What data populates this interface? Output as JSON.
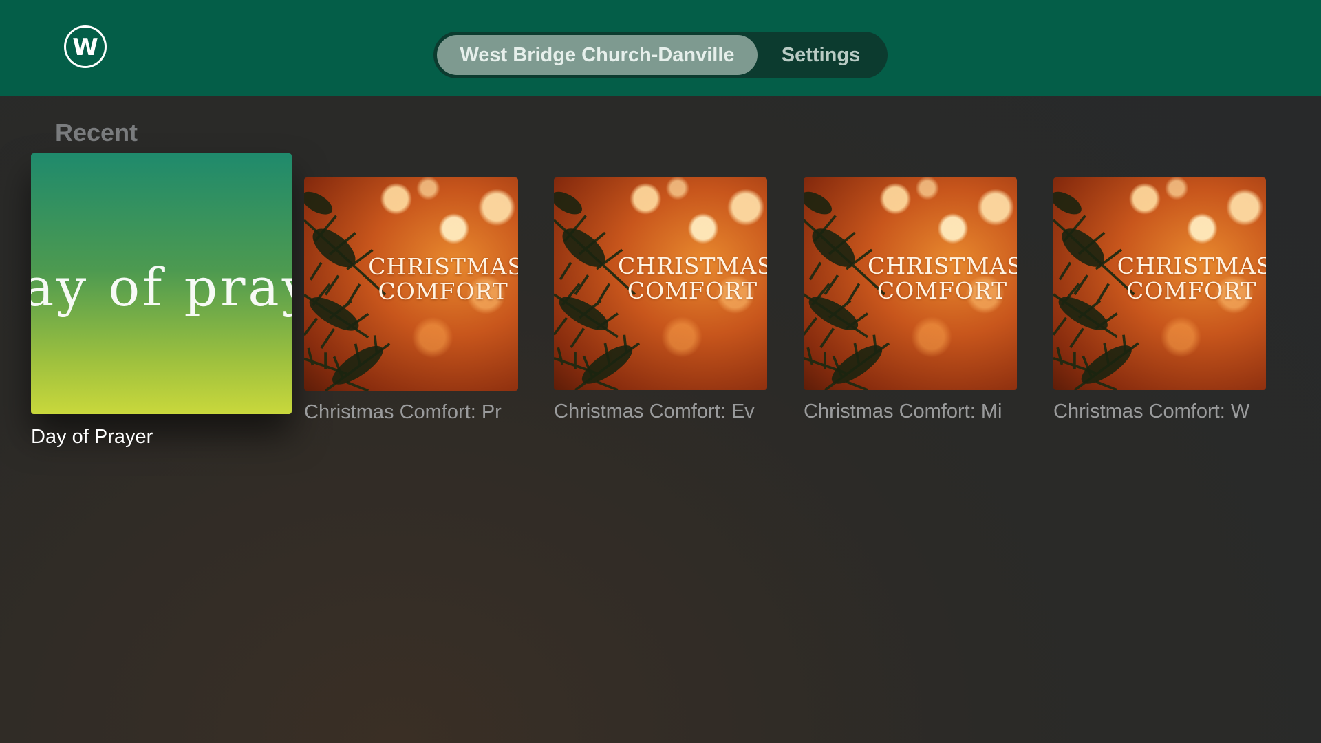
{
  "header": {
    "logo_letter": "W",
    "tabs": [
      {
        "label": "West Bridge Church-Danville",
        "active": true
      },
      {
        "label": "Settings",
        "active": false
      }
    ],
    "bar_color": "#045e48"
  },
  "recent": {
    "title": "Recent",
    "items": [
      {
        "label": "Day of Prayer",
        "artwork_text": "ay of praye",
        "focused": true
      },
      {
        "label": "Christmas Comfort: Pr",
        "artwork_line1": "CHRISTMAS",
        "artwork_line2": "COMFORT",
        "focused": false
      },
      {
        "label": "Christmas Comfort: Ev",
        "artwork_line1": "CHRISTMAS",
        "artwork_line2": "COMFORT",
        "focused": false
      },
      {
        "label": "Christmas Comfort: Mi",
        "artwork_line1": "CHRISTMAS",
        "artwork_line2": "COMFORT",
        "focused": false
      },
      {
        "label": "Christmas Comfort: W",
        "artwork_line1": "CHRISTMAS",
        "artwork_line2": "COMFORT",
        "focused": false
      }
    ]
  }
}
